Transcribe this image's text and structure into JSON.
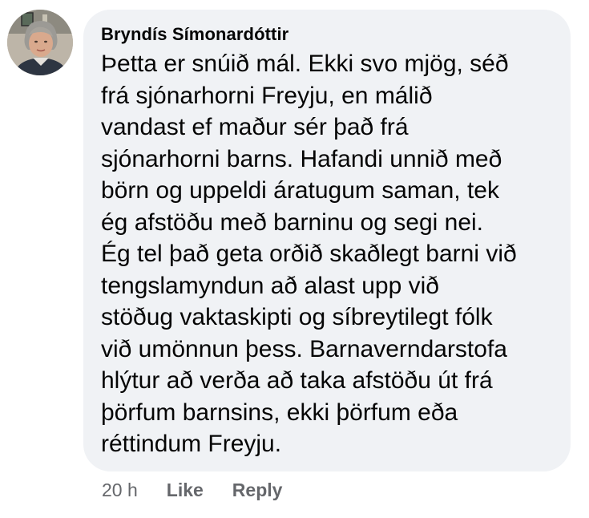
{
  "comment": {
    "author": "Bryndís Símonardóttir",
    "text": "Þetta er snúið mál. Ekki svo mjög, séð\nfrá sjónarhorni Freyju, en málið\nvandast ef maður sér það frá\nsjónarhorni barns. Hafandi unnið með\nbörn og uppeldi áratugum saman, tek\nég afstöðu með barninu og segi nei.\nÉg tel það geta orðið skaðlegt barni við\ntengslamyndun að alast upp við\nstöðug vaktaskipti og síbreytilegt fólk\nvið umönnun þess. Barnaverndarstofa\nhlýtur að verða að taka afstöðu út frá\nþörfum barnsins, ekki þörfum eða\nréttindum Freyju."
  },
  "actions": {
    "timestamp": "20 h",
    "like_label": "Like",
    "reply_label": "Reply"
  },
  "colors": {
    "bubble": "#f0f2f5",
    "text": "#050505",
    "secondary": "#65676b"
  }
}
